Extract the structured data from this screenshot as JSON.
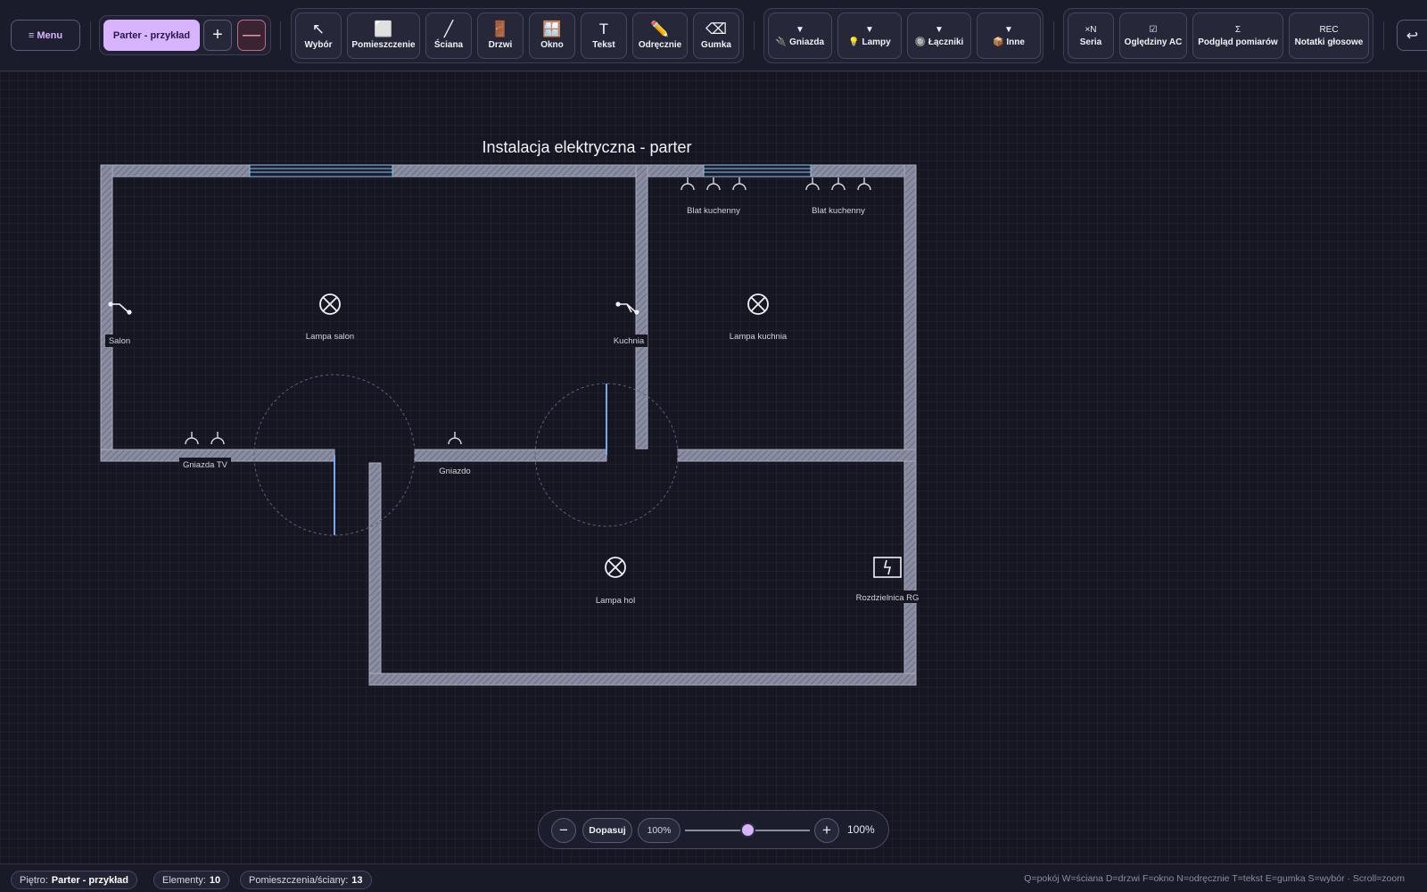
{
  "topbar": {
    "menu_label": "≡ Menu",
    "floor_tab_label": "Parter - przykład",
    "add_floor_glyph": "+",
    "remove_floor_glyph": "—",
    "tools": [
      {
        "id": "select",
        "icon": "↖",
        "label": "Wybór"
      },
      {
        "id": "room",
        "icon": "⬜",
        "label": "Pomieszczenie"
      },
      {
        "id": "wall",
        "icon": "╱",
        "label": "Ściana"
      },
      {
        "id": "door",
        "icon": "🚪",
        "label": "Drzwi"
      },
      {
        "id": "window",
        "icon": "🪟",
        "label": "Okno"
      },
      {
        "id": "text",
        "icon": "T",
        "label": "Tekst"
      },
      {
        "id": "freehand",
        "icon": "✏️",
        "label": "Odręcznie"
      },
      {
        "id": "eraser",
        "icon": "⌫",
        "label": "Gumka"
      }
    ],
    "symbol_menus": [
      {
        "id": "sockets",
        "arrow": "▼",
        "icon": "🔌",
        "label": "Gniazda"
      },
      {
        "id": "lamps",
        "arrow": "▼",
        "icon": "💡",
        "label": "Lampy"
      },
      {
        "id": "switches",
        "arrow": "▼",
        "icon": "🔘",
        "label": "Łączniki"
      },
      {
        "id": "other",
        "arrow": "▼",
        "icon": "📦",
        "label": "Inne"
      }
    ],
    "extra_tools": [
      {
        "id": "series",
        "icon": "×N",
        "label": "Seria"
      },
      {
        "id": "inspection",
        "icon": "☑",
        "label": "Oględziny AC"
      },
      {
        "id": "measurements",
        "icon": "Σ",
        "label": "Podgląd pomiarów"
      },
      {
        "id": "voice-notes",
        "icon": "REC",
        "label": "Notatki głosowe"
      }
    ],
    "undo_glyph": "↩"
  },
  "plan": {
    "title": "Instalacja elektryczna - parter",
    "wall_color": "#8a8ca0",
    "window_color": "#8cc4f0",
    "door_color": "#7aa8e8",
    "labels": {
      "blat1": "Blat kuchenny",
      "blat2": "Blat kuchenny",
      "lamp_salon": "Lampa salon",
      "lamp_kitchen": "Lampa kuchnia",
      "lamp_hall": "Lampa hol",
      "switch_salon": "Salon",
      "switch_kitchen": "Kuchnia",
      "sockets_tv": "Gniazda TV",
      "socket": "Gniazdo",
      "panel": "Rozdzielnica RG"
    }
  },
  "zoom": {
    "minus_glyph": "−",
    "fit_label": "Dopasuj",
    "value_pill": "100%",
    "plus_glyph": "+",
    "value_text": "100%",
    "slider_level": 0.5
  },
  "status": {
    "floor_label": "Piętro:",
    "floor_value": "Parter - przykład",
    "elements_label": "Elementy:",
    "elements_value": "10",
    "rooms_label": "Pomieszczenia/ściany:",
    "rooms_value": "13",
    "shortcuts_hint": "Q=pokój W=ściana D=drzwi F=okno N=odręcznie T=tekst E=gumka S=wybór · Scroll=zoom"
  },
  "accent_color": "#d8b4fe"
}
